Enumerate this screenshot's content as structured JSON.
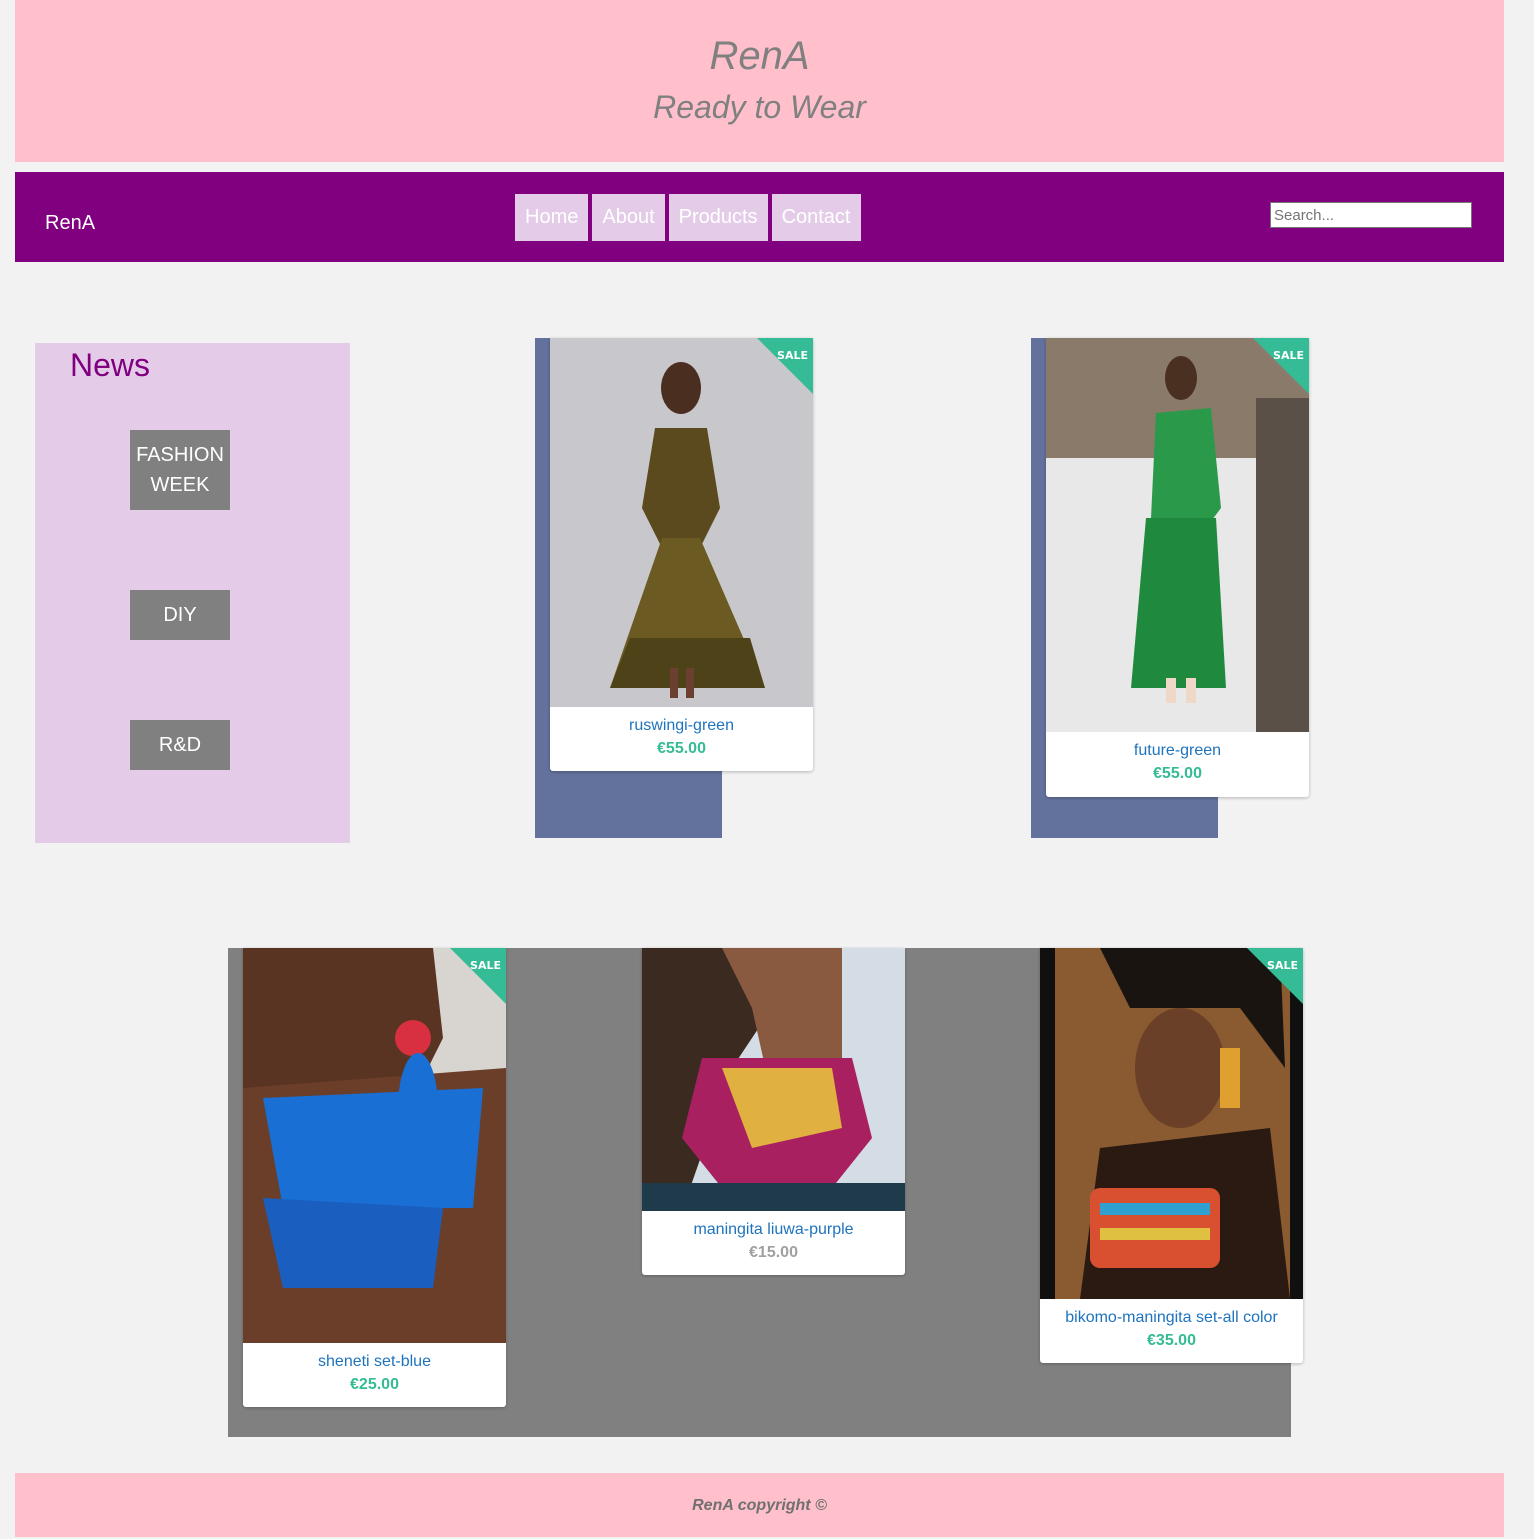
{
  "header": {
    "brand": "RenA",
    "tagline": "Ready to Wear"
  },
  "nav": {
    "logo": "RenA",
    "links": [
      "Home",
      "About",
      "Products",
      "Contact"
    ],
    "search_placeholder": "Search..."
  },
  "news": {
    "title": "News",
    "buttons": [
      "FASHION WEEK",
      "DIY",
      "R&D"
    ]
  },
  "sale_badge": "SALE",
  "products": [
    {
      "name": "ruswingi-green",
      "price": "€55.00",
      "on_sale": true
    },
    {
      "name": "future-green",
      "price": "€55.00",
      "on_sale": true
    },
    {
      "name": "sheneti set-blue",
      "price": "€25.00",
      "on_sale": true
    },
    {
      "name": "maningita liuwa-purple",
      "price": "€15.00",
      "on_sale": false
    },
    {
      "name": "bikomo-maningita set-all color",
      "price": "€35.00",
      "on_sale": true
    }
  ],
  "footer": {
    "text": "RenA copyright ©"
  },
  "colors": {
    "banner": "#ffc0cb",
    "nav": "#800080",
    "nav_link": "#e4cce8",
    "slab": "#63729c",
    "gallery": "#808080",
    "sale": "#35bb95",
    "product_link": "#1e73be"
  }
}
